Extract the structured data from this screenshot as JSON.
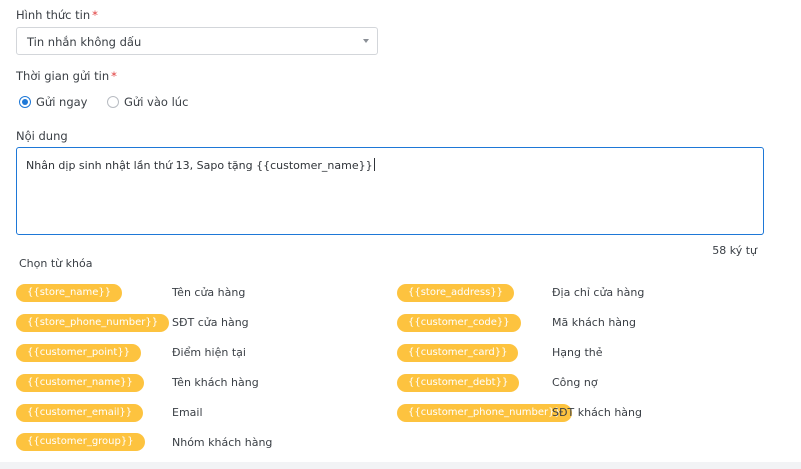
{
  "form": {
    "message_type_label": "Hình thức tin",
    "message_type_value": "Tin nhắn không dấu",
    "send_time_label": "Thời gian gửi tin",
    "send_now_label": "Gửi ngay",
    "send_later_label": "Gửi vào lúc",
    "send_time_selected": "Gửi ngay",
    "content_label": "Nội dung",
    "content_value": "Nhân dịp sinh nhật lần thứ 13, Sapo tặng {{customer_name}}",
    "char_count": "58 ký tự",
    "required_mark": "*"
  },
  "keywords": {
    "title": "Chọn từ khóa",
    "left": [
      {
        "tag": "{{store_name}}",
        "desc": "Tên cửa hàng"
      },
      {
        "tag": "{{store_phone_number}}",
        "desc": "SĐT cửa hàng"
      },
      {
        "tag": "{{customer_point}}",
        "desc": "Điểm hiện tại"
      },
      {
        "tag": "{{customer_name}}",
        "desc": "Tên khách hàng"
      },
      {
        "tag": "{{customer_email}}",
        "desc": "Email"
      },
      {
        "tag": "{{customer_group}}",
        "desc": "Nhóm khách hàng"
      }
    ],
    "right": [
      {
        "tag": "{{store_address}}",
        "desc": "Địa chỉ cửa hàng"
      },
      {
        "tag": "{{customer_code}}",
        "desc": "Mã khách hàng"
      },
      {
        "tag": "{{customer_card}}",
        "desc": "Hạng thẻ"
      },
      {
        "tag": "{{customer_debt}}",
        "desc": "Công nợ"
      },
      {
        "tag": "{{customer_phone_number}}",
        "desc": "SĐT khách hàng"
      }
    ]
  },
  "colors": {
    "accent": "#1e78d7",
    "tag_bg": "#fdc33f",
    "required": "#e03b3b"
  }
}
